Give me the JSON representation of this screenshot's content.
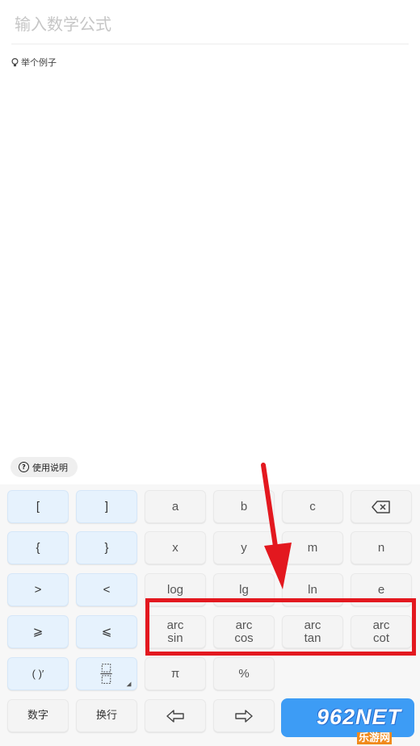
{
  "input": {
    "placeholder": "输入数学公式"
  },
  "example": {
    "label": "举个例子"
  },
  "help": {
    "label": "使用说明"
  },
  "keys": {
    "open_bracket": "[",
    "close_bracket": "]",
    "a": "a",
    "b": "b",
    "c": "c",
    "open_brace": "{",
    "close_brace": "}",
    "x": "x",
    "y": "y",
    "m": "m",
    "n": "n",
    "greater": ">",
    "less": "<",
    "log": "log",
    "lg": "lg",
    "ln": "ln",
    "e": "e",
    "geq": "⩾",
    "leq": "⩽",
    "arcsin": [
      "arc",
      "sin"
    ],
    "arccos": [
      "arc",
      "cos"
    ],
    "arctan": [
      "arc",
      "tan"
    ],
    "arccot": [
      "arc",
      "cot"
    ],
    "paren_prime": "( )′",
    "pi": "π",
    "percent": "%",
    "numbers": "数字",
    "newline": "换行",
    "left_arrow": "⇦",
    "right_arrow": "⇨"
  },
  "watermark": {
    "big": "962NET",
    "small": "乐游网"
  },
  "colors": {
    "highlight": "#e3181f",
    "arrow": "#e3181f",
    "blue_key": "#e6f2fd",
    "enter": "#3d9cf5"
  }
}
